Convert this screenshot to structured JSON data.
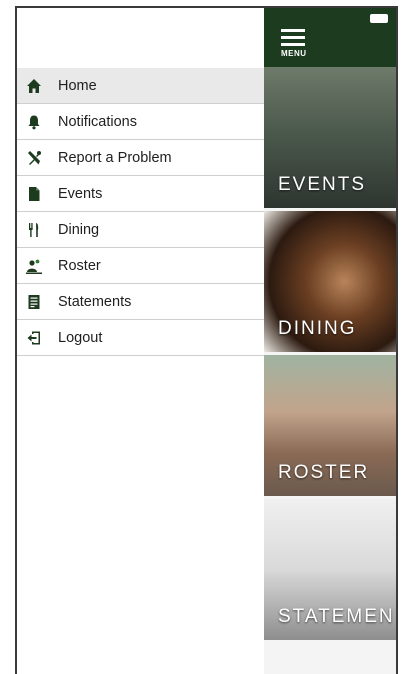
{
  "drawer": {
    "items": [
      {
        "label": "Home",
        "icon": "home-icon",
        "active": true
      },
      {
        "label": "Notifications",
        "icon": "bell-icon",
        "active": false
      },
      {
        "label": "Report a Problem",
        "icon": "tools-icon",
        "active": false
      },
      {
        "label": "Events",
        "icon": "document-icon",
        "active": false
      },
      {
        "label": "Dining",
        "icon": "utensils-icon",
        "active": false
      },
      {
        "label": "Roster",
        "icon": "people-icon",
        "active": false
      },
      {
        "label": "Statements",
        "icon": "statement-icon",
        "active": false
      },
      {
        "label": "Logout",
        "icon": "logout-icon",
        "active": false
      }
    ]
  },
  "topbar": {
    "menu_label": "MENU",
    "background": "#1d3b1f"
  },
  "tiles": [
    {
      "label": "EVENTS"
    },
    {
      "label": "DINING"
    },
    {
      "label": "ROSTER"
    },
    {
      "label": "STATEMEN"
    }
  ],
  "colors": {
    "icon": "#1d3b1f",
    "active_row": "#e9e9e9"
  }
}
